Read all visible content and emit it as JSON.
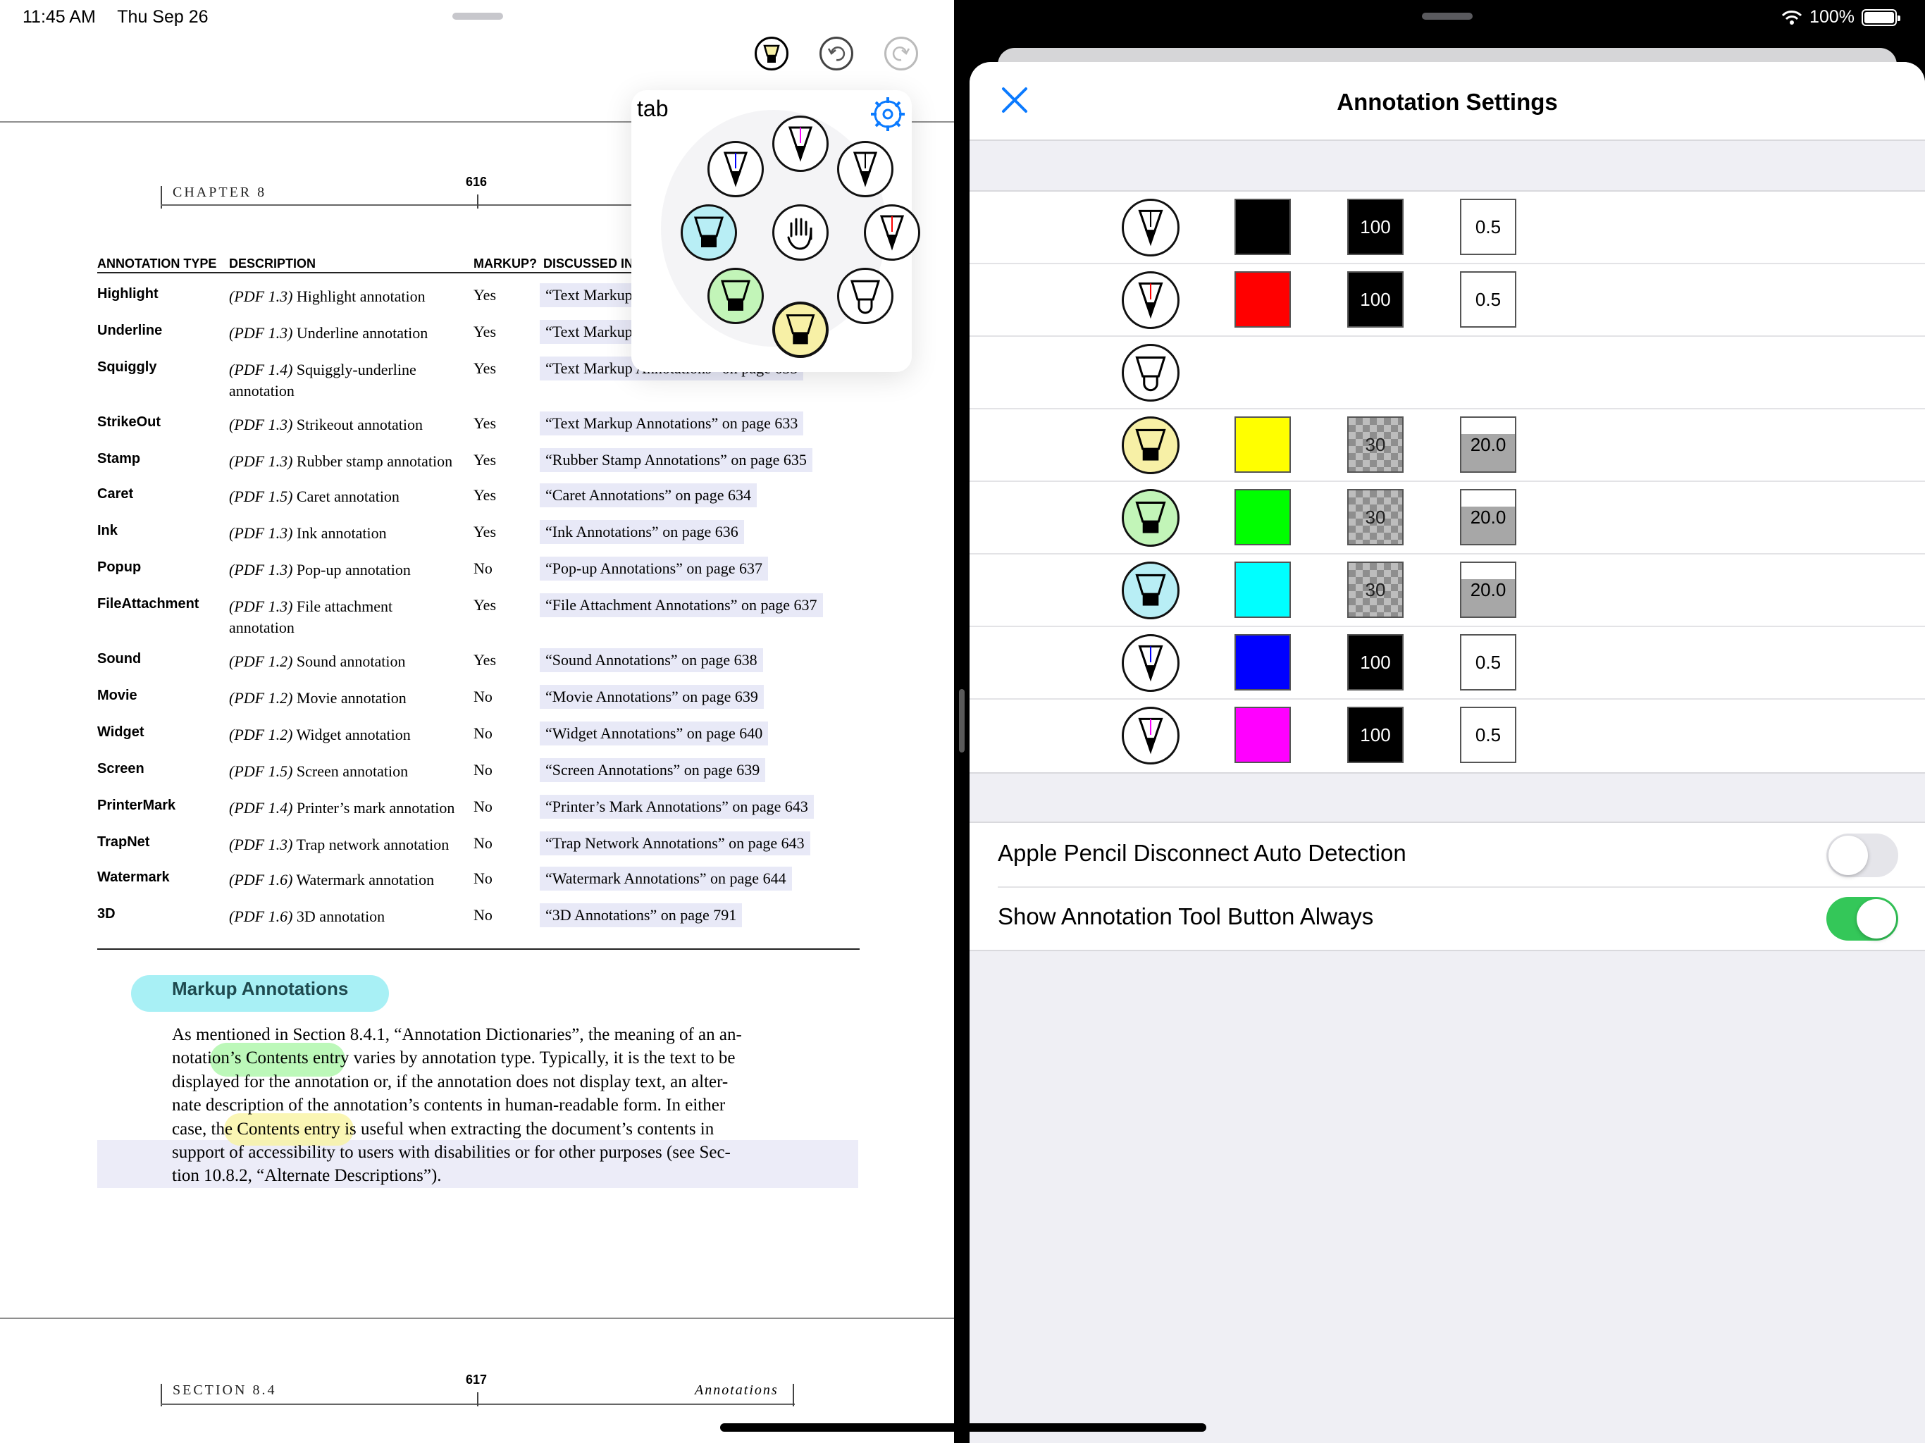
{
  "status_bar": {
    "time": "11:45 AM",
    "date": "Thu Sep 26",
    "battery": "100%"
  },
  "toolbar": {
    "tool_icon": "highlighter-icon",
    "undo_icon": "undo-icon",
    "redo_icon": "redo-icon"
  },
  "tool_popover": {
    "label": "tab",
    "settings_icon": "gear-icon",
    "center_icon": "hand-icon"
  },
  "pdf": {
    "top_page": {
      "header_left": "CHAPTER 8",
      "page_number": "616"
    },
    "table": {
      "columns": [
        "ANNOTATION TYPE",
        "DESCRIPTION",
        "MARKUP?",
        "DISCUSSED IN"
      ],
      "rows": [
        {
          "type": "Highlight",
          "version": "(PDF 1.3)",
          "desc": "Highlight annotation",
          "desc2": "",
          "markup": "Yes",
          "disc": "“Text Markup Annotations” on page 633"
        },
        {
          "type": "Underline",
          "version": "(PDF 1.3)",
          "desc": "Underline annotation",
          "desc2": "",
          "markup": "Yes",
          "disc": "“Text Markup Annotations” on page 633"
        },
        {
          "type": "Squiggly",
          "version": "(PDF 1.4)",
          "desc": "Squiggly-underline",
          "desc2": "annotation",
          "markup": "Yes",
          "disc": "“Text Markup Annotations” on page 633"
        },
        {
          "type": "StrikeOut",
          "version": "(PDF 1.3)",
          "desc": "Strikeout annotation",
          "desc2": "",
          "markup": "Yes",
          "disc": "“Text Markup Annotations” on page 633"
        },
        {
          "type": "Stamp",
          "version": "(PDF 1.3)",
          "desc": "Rubber stamp annotation",
          "desc2": "",
          "markup": "Yes",
          "disc": "“Rubber Stamp Annotations” on page 635"
        },
        {
          "type": "Caret",
          "version": "(PDF 1.5)",
          "desc": "Caret annotation",
          "desc2": "",
          "markup": "Yes",
          "disc": "“Caret Annotations” on page 634"
        },
        {
          "type": "Ink",
          "version": "(PDF 1.3)",
          "desc": "Ink annotation",
          "desc2": "",
          "markup": "Yes",
          "disc": "“Ink Annotations” on page 636"
        },
        {
          "type": "Popup",
          "version": "(PDF 1.3)",
          "desc": "Pop-up annotation",
          "desc2": "",
          "markup": "No",
          "disc": "“Pop-up Annotations” on page 637"
        },
        {
          "type": "FileAttachment",
          "version": "(PDF 1.3)",
          "desc": "File attachment",
          "desc2": "annotation",
          "markup": "Yes",
          "disc": "“File Attachment Annotations” on page 637"
        },
        {
          "type": "Sound",
          "version": "(PDF 1.2)",
          "desc": "Sound annotation",
          "desc2": "",
          "markup": "Yes",
          "disc": "“Sound Annotations” on page 638"
        },
        {
          "type": "Movie",
          "version": "(PDF 1.2)",
          "desc": "Movie annotation",
          "desc2": "",
          "markup": "No",
          "disc": "“Movie Annotations” on page 639"
        },
        {
          "type": "Widget",
          "version": "(PDF 1.2)",
          "desc": "Widget annotation",
          "desc2": "",
          "markup": "No",
          "disc": "“Widget Annotations” on page 640"
        },
        {
          "type": "Screen",
          "version": "(PDF 1.5)",
          "desc": "Screen annotation",
          "desc2": "",
          "markup": "No",
          "disc": "“Screen Annotations” on page 639"
        },
        {
          "type": "PrinterMark",
          "version": "(PDF 1.4)",
          "desc": "Printer’s mark annotation",
          "desc2": "",
          "markup": "No",
          "disc": "“Printer’s Mark Annotations” on page 643"
        },
        {
          "type": "TrapNet",
          "version": "(PDF 1.3)",
          "desc": "Trap network annotation",
          "desc2": "",
          "markup": "No",
          "disc": "“Trap Network Annotations” on page 643"
        },
        {
          "type": "Watermark",
          "version": "(PDF 1.6)",
          "desc": "Watermark annotation",
          "desc2": "",
          "markup": "No",
          "disc": "“Watermark Annotations” on page 644"
        },
        {
          "type": "3D",
          "version": "(PDF 1.6)",
          "desc": "3D annotation",
          "desc2": "",
          "markup": "No",
          "disc": "“3D Annotations” on page 791"
        }
      ]
    },
    "section_title": "Markup Annotations",
    "paragraph_lines": [
      "As mentioned in Section 8.4.1, “Annotation Dictionaries”, the meaning of an an-",
      "notation’s Contents entry varies by annotation type. Typically, it is the text to be",
      "displayed for the annotation or, if the annotation does not display text, an alter-",
      "nate description of the annotation’s contents in human-readable form. In either",
      "case, the Contents entry is useful when extracting the document’s contents in",
      "support of accessibility to users with disabilities or for other purposes (see Sec-",
      "tion 10.8.2, “Alternate Descriptions”)."
    ],
    "bottom_page": {
      "header_left": "SECTION 8.4",
      "page_number": "617",
      "header_right": "Annotations"
    }
  },
  "settings": {
    "title": "Annotation Settings",
    "close_icon": "close-icon",
    "tools": [
      {
        "icon": "pen-icon",
        "tip_color": "#000000",
        "fill": "#ffffff",
        "color": "#000000",
        "opacity": "100",
        "width": "0.5",
        "style": "solid",
        "thick": false
      },
      {
        "icon": "pen-icon",
        "tip_color": "#ff0000",
        "fill": "#ffffff",
        "color": "#ff0000",
        "opacity": "100",
        "width": "0.5",
        "style": "solid",
        "thick": false
      },
      {
        "icon": "eraser-icon",
        "tip_color": "",
        "fill": "#ffffff",
        "color": "",
        "opacity": "",
        "width": "",
        "style": "",
        "thick": false
      },
      {
        "icon": "highlighter-icon",
        "tip_color": "",
        "fill": "#f7f0a6",
        "color": "#ffff00",
        "opacity": "30",
        "width": "20.0",
        "style": "checker",
        "thick": true
      },
      {
        "icon": "highlighter-icon",
        "tip_color": "",
        "fill": "#c2f5b8",
        "color": "#00ff00",
        "opacity": "30",
        "width": "20.0",
        "style": "checker",
        "thick": true
      },
      {
        "icon": "highlighter-icon",
        "tip_color": "",
        "fill": "#b8eef5",
        "color": "#00ffff",
        "opacity": "30",
        "width": "20.0",
        "style": "checker",
        "thick": true
      },
      {
        "icon": "pen-icon",
        "tip_color": "#0000ff",
        "fill": "#ffffff",
        "color": "#0000ff",
        "opacity": "100",
        "width": "0.5",
        "style": "solid",
        "thick": false
      },
      {
        "icon": "pen-icon",
        "tip_color": "#ff00ff",
        "fill": "#ffffff",
        "color": "#ff00ff",
        "opacity": "100",
        "width": "0.5",
        "style": "solid",
        "thick": false
      }
    ],
    "toggles": [
      {
        "label": "Apple Pencil Disconnect Auto Detection",
        "on": false
      },
      {
        "label": "Show Annotation Tool Button Always",
        "on": true
      }
    ]
  },
  "colors": {
    "accent": "#0a7aff",
    "toggle_on": "#34c759",
    "highlight_cyan": "#a8f0f5",
    "highlight_green": "#9ff59b",
    "highlight_yellow": "#f9f4a1"
  }
}
